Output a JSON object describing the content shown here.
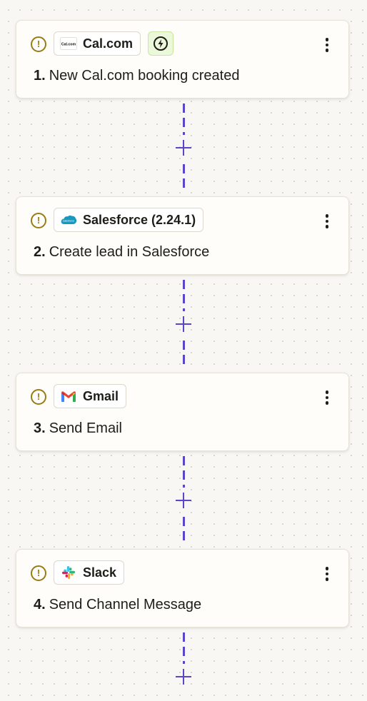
{
  "steps": [
    {
      "number": "1.",
      "title": "New Cal.com booking created",
      "app": "Cal.com",
      "logo_text": "Cal.com",
      "logo_icon": "calcom-logo-icon",
      "trigger_icon": "lightning-bolt-icon",
      "status_icon": "warning-icon"
    },
    {
      "number": "2.",
      "title": "Create lead in Salesforce",
      "app": "Salesforce (2.24.1)",
      "logo_text": "salesforce",
      "logo_icon": "salesforce-cloud-icon",
      "status_icon": "warning-icon"
    },
    {
      "number": "3.",
      "title": "Send Email",
      "app": "Gmail",
      "logo_icon": "gmail-icon",
      "status_icon": "warning-icon"
    },
    {
      "number": "4.",
      "title": "Send Channel Message",
      "app": "Slack",
      "logo_icon": "slack-icon",
      "status_icon": "warning-icon"
    }
  ],
  "colors": {
    "connector": "#5a46c9",
    "warning": "#9a7b15",
    "trigger_bg": "#ecf8da",
    "canvas": "#f8f7f3"
  },
  "labels": {
    "warning_glyph": "!"
  }
}
